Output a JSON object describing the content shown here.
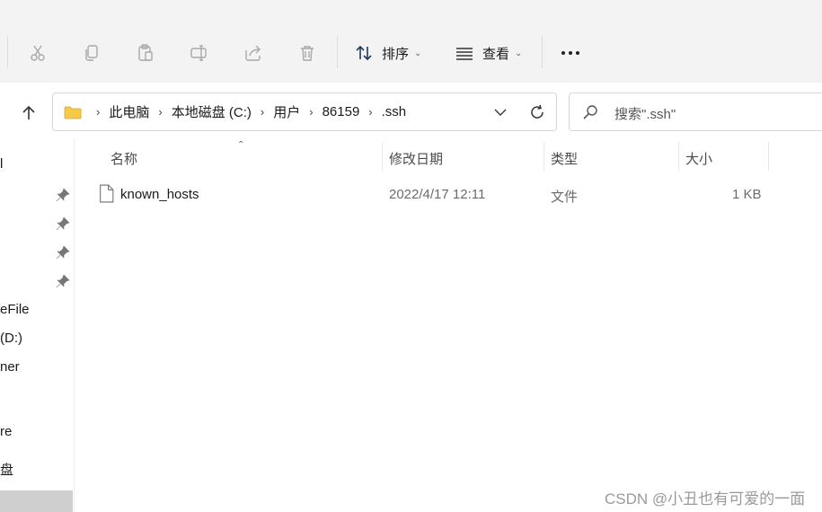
{
  "toolbar": {
    "sort_label": "排序",
    "view_label": "查看",
    "icons": [
      "cut-icon",
      "copy-icon",
      "paste-icon",
      "rename-icon",
      "share-icon",
      "delete-icon",
      "sort-icon",
      "view-icon",
      "more-icon"
    ]
  },
  "breadcrumb": {
    "items": [
      "此电脑",
      "本地磁盘 (C:)",
      "用户",
      "86159",
      ".ssh"
    ]
  },
  "search": {
    "placeholder": "搜索\".ssh\""
  },
  "sidebar": {
    "fragments": [
      "l",
      "eFile",
      "(D:)",
      "ner",
      "re",
      "盘"
    ]
  },
  "columns": {
    "name": "名称",
    "date": "修改日期",
    "type": "类型",
    "size": "大小"
  },
  "files": [
    {
      "name": "known_hosts",
      "date": "2022/4/17 12:11",
      "type": "文件",
      "size": "1 KB"
    }
  ],
  "watermark": "CSDN @小丑也有可爱的一面"
}
